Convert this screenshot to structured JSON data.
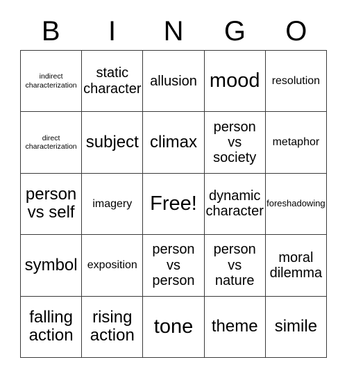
{
  "card": {
    "title": "BINGO",
    "header_letters": [
      "B",
      "I",
      "N",
      "G",
      "O"
    ],
    "columns": 5,
    "rows": 5,
    "border_color": "#3a3a3a",
    "background_color": "#ffffff",
    "text_color": "#000000",
    "free_space": {
      "row": 2,
      "column": 2,
      "label": "Free!"
    },
    "cells": [
      [
        {
          "text": "indirect\ncharacterization",
          "size": "xs"
        },
        {
          "text": "static\ncharacter",
          "size": "lg"
        },
        {
          "text": "allusion",
          "size": "lg"
        },
        {
          "text": "mood",
          "size": "xxl"
        },
        {
          "text": "resolution",
          "size": "md"
        }
      ],
      [
        {
          "text": "direct\ncharacterization",
          "size": "xs"
        },
        {
          "text": "subject",
          "size": "xl"
        },
        {
          "text": "climax",
          "size": "xl"
        },
        {
          "text": "person\nvs\nsociety",
          "size": "lg"
        },
        {
          "text": "metaphor",
          "size": "md"
        }
      ],
      [
        {
          "text": "person\nvs self",
          "size": "xl"
        },
        {
          "text": "imagery",
          "size": "md"
        },
        {
          "text": "Free!",
          "size": "xxl"
        },
        {
          "text": "dynamic\ncharacter",
          "size": "lg"
        },
        {
          "text": "foreshadowing",
          "size": "sm"
        }
      ],
      [
        {
          "text": "symbol",
          "size": "xl"
        },
        {
          "text": "exposition",
          "size": "md"
        },
        {
          "text": "person\nvs\nperson",
          "size": "lg"
        },
        {
          "text": "person\nvs\nnature",
          "size": "lg"
        },
        {
          "text": "moral\ndilemma",
          "size": "lg"
        }
      ],
      [
        {
          "text": "falling\naction",
          "size": "xl"
        },
        {
          "text": "rising\naction",
          "size": "xl"
        },
        {
          "text": "tone",
          "size": "xxl"
        },
        {
          "text": "theme",
          "size": "xl"
        },
        {
          "text": "simile",
          "size": "xl"
        }
      ]
    ]
  }
}
